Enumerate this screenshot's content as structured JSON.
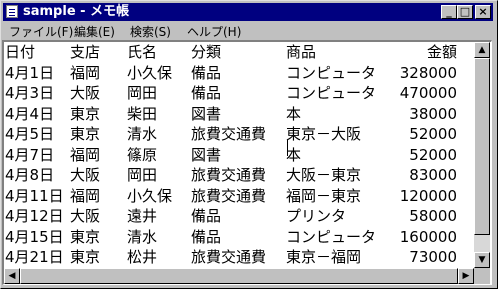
{
  "window": {
    "title": "sample - メモ帳"
  },
  "title_buttons": {
    "minimize": "_",
    "maximize": "□",
    "close": "×"
  },
  "menu": [
    {
      "label": "ファイル(F)"
    },
    {
      "label": "編集(E)"
    },
    {
      "label": "検索(S)"
    },
    {
      "label": "ヘルプ(H)"
    }
  ],
  "table": {
    "headers": [
      "日付",
      "支店",
      "氏名",
      "分類",
      "商品",
      "金額"
    ],
    "rows": [
      [
        "4月1日",
        "福岡",
        "小久保",
        "備品",
        "コンピュータ",
        "328000"
      ],
      [
        "4月3日",
        "大阪",
        "岡田",
        "備品",
        "コンピュータ",
        "470000"
      ],
      [
        "4月4日",
        "東京",
        "柴田",
        "図書",
        "本",
        "38000"
      ],
      [
        "4月5日",
        "東京",
        "清水",
        "旅費交通費",
        "東京－大阪",
        "52000"
      ],
      [
        "4月7日",
        "福岡",
        "篠原",
        "図書",
        "本",
        "52000"
      ],
      [
        "4月8日",
        "大阪",
        "岡田",
        "旅費交通費",
        "大阪－東京",
        "83000"
      ],
      [
        "4月11日",
        "福岡",
        "小久保",
        "旅費交通費",
        "福岡－東京",
        "120000"
      ],
      [
        "4月12日",
        "大阪",
        "遠井",
        "備品",
        "プリンタ",
        "58000"
      ],
      [
        "4月15日",
        "東京",
        "清水",
        "備品",
        "コンピュータ",
        "160000"
      ],
      [
        "4月21日",
        "東京",
        "松井",
        "旅費交通費",
        "東京－福岡",
        "73000"
      ],
      [
        "4月22日",
        "福岡",
        "篠原",
        "旅費交通費",
        "福岡－大阪",
        "48000"
      ]
    ]
  },
  "scrollbar_glyphs": {
    "up": "▲",
    "down": "▼",
    "left": "◀",
    "right": "▶"
  }
}
